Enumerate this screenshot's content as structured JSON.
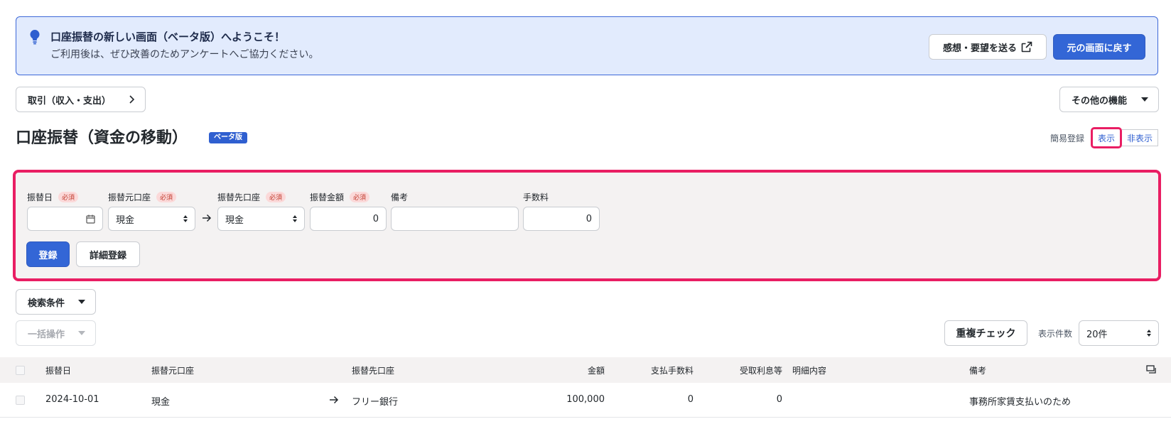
{
  "banner": {
    "title": "口座振替の新しい画面（ベータ版）へようこそ！",
    "subtitle": "ご利用後は、ぜひ改善のためアンケートへご協力ください。",
    "feedback_label": "感想・要望を送る",
    "back_label": "元の画面に戻す"
  },
  "nav": {
    "breadcrumb_label": "取引（収入・支出）",
    "other_features_label": "その他の機能"
  },
  "page": {
    "title": "口座振替（資金の移動）",
    "beta_badge": "ベータ版",
    "quick_entry_label": "簡易登録",
    "show_label": "表示",
    "hide_label": "非表示"
  },
  "form": {
    "required_badge": "必須",
    "date_label": "振替日",
    "date_value": "",
    "from_label": "振替元口座",
    "from_value": "現金",
    "to_label": "振替先口座",
    "to_value": "現金",
    "amount_label": "振替金額",
    "amount_value": "0",
    "memo_label": "備考",
    "memo_value": "",
    "fee_label": "手数料",
    "fee_value": "0",
    "register_label": "登録",
    "detail_register_label": "詳細登録"
  },
  "controls": {
    "search_conditions_label": "検索条件",
    "bulk_actions_label": "一括操作",
    "duplicate_check_label": "重複チェック",
    "display_count_label": "表示件数",
    "display_count_value": "20件"
  },
  "table": {
    "headers": {
      "date": "振替日",
      "from": "振替元口座",
      "to": "振替先口座",
      "amount": "金額",
      "fee_paid": "支払手数料",
      "interest_received": "受取利息等",
      "detail": "明細内容",
      "memo": "備考"
    },
    "rows": [
      {
        "date": "2024-10-01",
        "from": "現金",
        "to": "フリー銀行",
        "amount": "100,000",
        "fee_paid": "0",
        "interest_received": "0",
        "detail": "",
        "memo": "事務所家賃支払いのため"
      }
    ]
  },
  "colors": {
    "accent": "#3366d6",
    "banner_bg": "#e2ebfd",
    "highlight": "#e91e63",
    "panel_bg": "#f4f2f2"
  }
}
